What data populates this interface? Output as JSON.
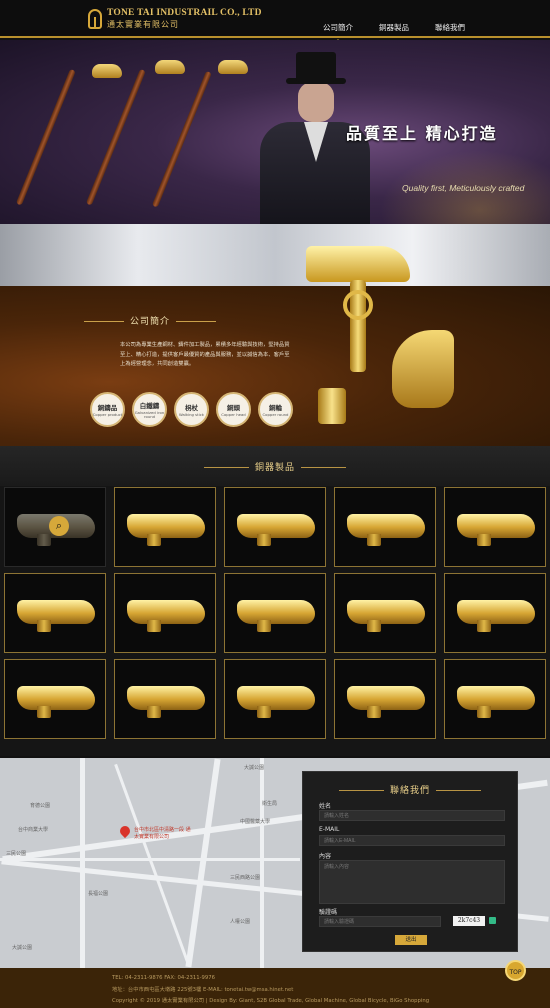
{
  "header": {
    "company_en": "TONE TAI INDUSTRAIL CO., LTD",
    "company_zh": "通太實業有限公司",
    "nav": [
      {
        "label": "公司簡介",
        "active": true
      },
      {
        "label": "銅器製品",
        "active": false
      },
      {
        "label": "聯絡我們",
        "active": false
      }
    ]
  },
  "hero": {
    "title": "品質至上 精心打造",
    "subtitle": "Quality first, Meticulously crafted"
  },
  "about": {
    "title": "公司簡介",
    "text": "本公司為專業生產銅材、鑄件加工製品，累積多年經驗與技術，堅持品質至上、精心打造，提供客戶最優質的產品與服務，並以誠信為本、客戶至上為經營理念，共同創造雙贏。",
    "badges": [
      {
        "zh": "銅鑄品",
        "en": "Copper product"
      },
      {
        "zh": "白鐵鑄",
        "en": "Galvanized iron round"
      },
      {
        "zh": "柺杖",
        "en": "Walking stick"
      },
      {
        "zh": "銅頭",
        "en": "Copper head"
      },
      {
        "zh": "銅輪",
        "en": "Copper round"
      }
    ]
  },
  "products": {
    "title": "銅器製品",
    "count": 15
  },
  "map": {
    "labels": [
      "大誠公園",
      "衛生局",
      "育德公園",
      "台中商業大學",
      "三民公園",
      "長福公園",
      "大誠公園",
      "中國醫藥大學",
      "三民西路公園",
      "人權公園"
    ],
    "pin_label": "台中市北區中清路一段 通太實業有限公司"
  },
  "contact": {
    "title": "聯絡我們",
    "name_label": "姓名",
    "name_placeholder": "請輸入姓名",
    "email_label": "E-MAIL",
    "email_placeholder": "請輸入E-MAIL",
    "content_label": "內容",
    "content_placeholder": "請輸入內容",
    "code_label": "驗證碼",
    "code_placeholder": "請輸入驗證碼",
    "captcha": "2k7c43",
    "submit_label": "送出"
  },
  "footer": {
    "line1": "TEL: 04-2311-9876    FAX: 04-2311-9976",
    "line2": "地址：台中市西屯區大墩路 225號3樓    E-MAIL: tonetai.tw@msa.hinet.net",
    "line3": "Copyright © 2019 通太實業有限公司 | Design By: Giant, S2B Global Trade, Global Machine, Global Bicycle, BiGo Shopping",
    "top_label": "TOP"
  },
  "colors": {
    "accent": "#d6a83a",
    "dark": "#111111"
  }
}
